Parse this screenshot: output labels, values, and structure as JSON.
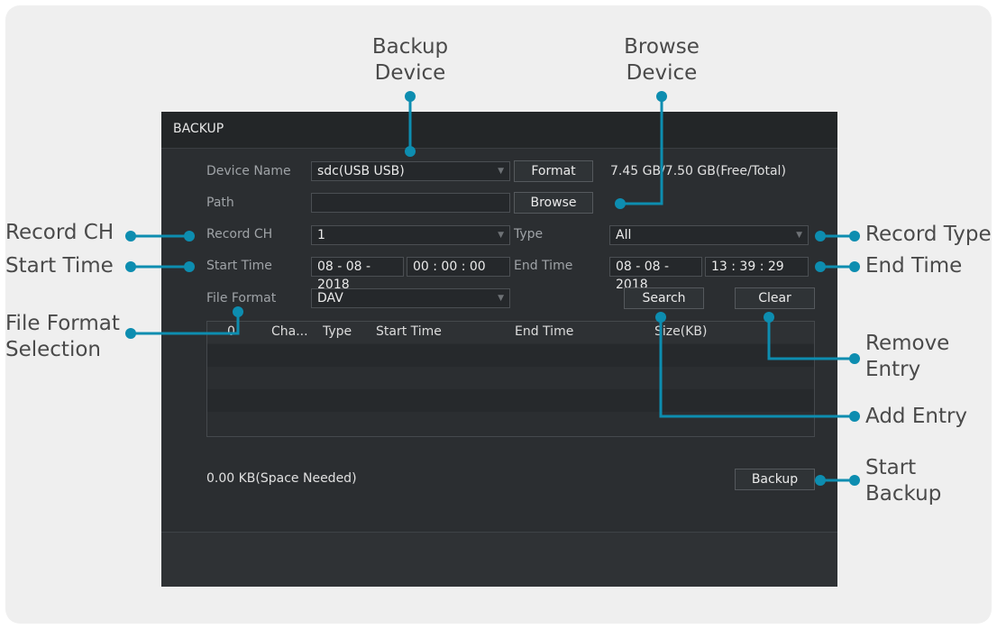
{
  "annotations": {
    "backup_device": [
      "Backup",
      "Device"
    ],
    "browse_device": [
      "Browse",
      "Device"
    ],
    "record_ch": "Record CH",
    "start_time": "Start Time",
    "file_format_selection": [
      "File Format",
      "Selection"
    ],
    "record_type": "Record Type",
    "end_time": "End Time",
    "remove_entry": [
      "Remove",
      "Entry"
    ],
    "add_entry": "Add Entry",
    "start_backup": [
      "Start",
      "Backup"
    ]
  },
  "panel": {
    "title": "BACKUP",
    "device_name_label": "Device Name",
    "device_name_value": "sdc(USB USB)",
    "format_button": "Format",
    "capacity": "7.45 GB/7.50 GB(Free/Total)",
    "path_label": "Path",
    "path_value": "",
    "browse_button": "Browse",
    "record_ch_label": "Record CH",
    "record_ch_value": "1",
    "type_label": "Type",
    "type_value": "All",
    "start_time_label": "Start Time",
    "start_date": "08 - 08 - 2018",
    "start_clock": "00 : 00 : 00",
    "end_time_label": "End Time",
    "end_date": "08 - 08 - 2018",
    "end_clock": "13 : 39 : 29",
    "file_format_label": "File Format",
    "file_format_value": "DAV",
    "search_button": "Search",
    "clear_button": "Clear",
    "table_headers": [
      "0",
      "Cha...",
      "Type",
      "Start Time",
      "End Time",
      "Size(KB)"
    ],
    "space_needed": "0.00 KB(Space Needed)",
    "backup_button": "Backup"
  },
  "colors": {
    "accent": "#0d8db0",
    "panel_bg": "#2b2e31",
    "card_bg": "#efefef"
  }
}
